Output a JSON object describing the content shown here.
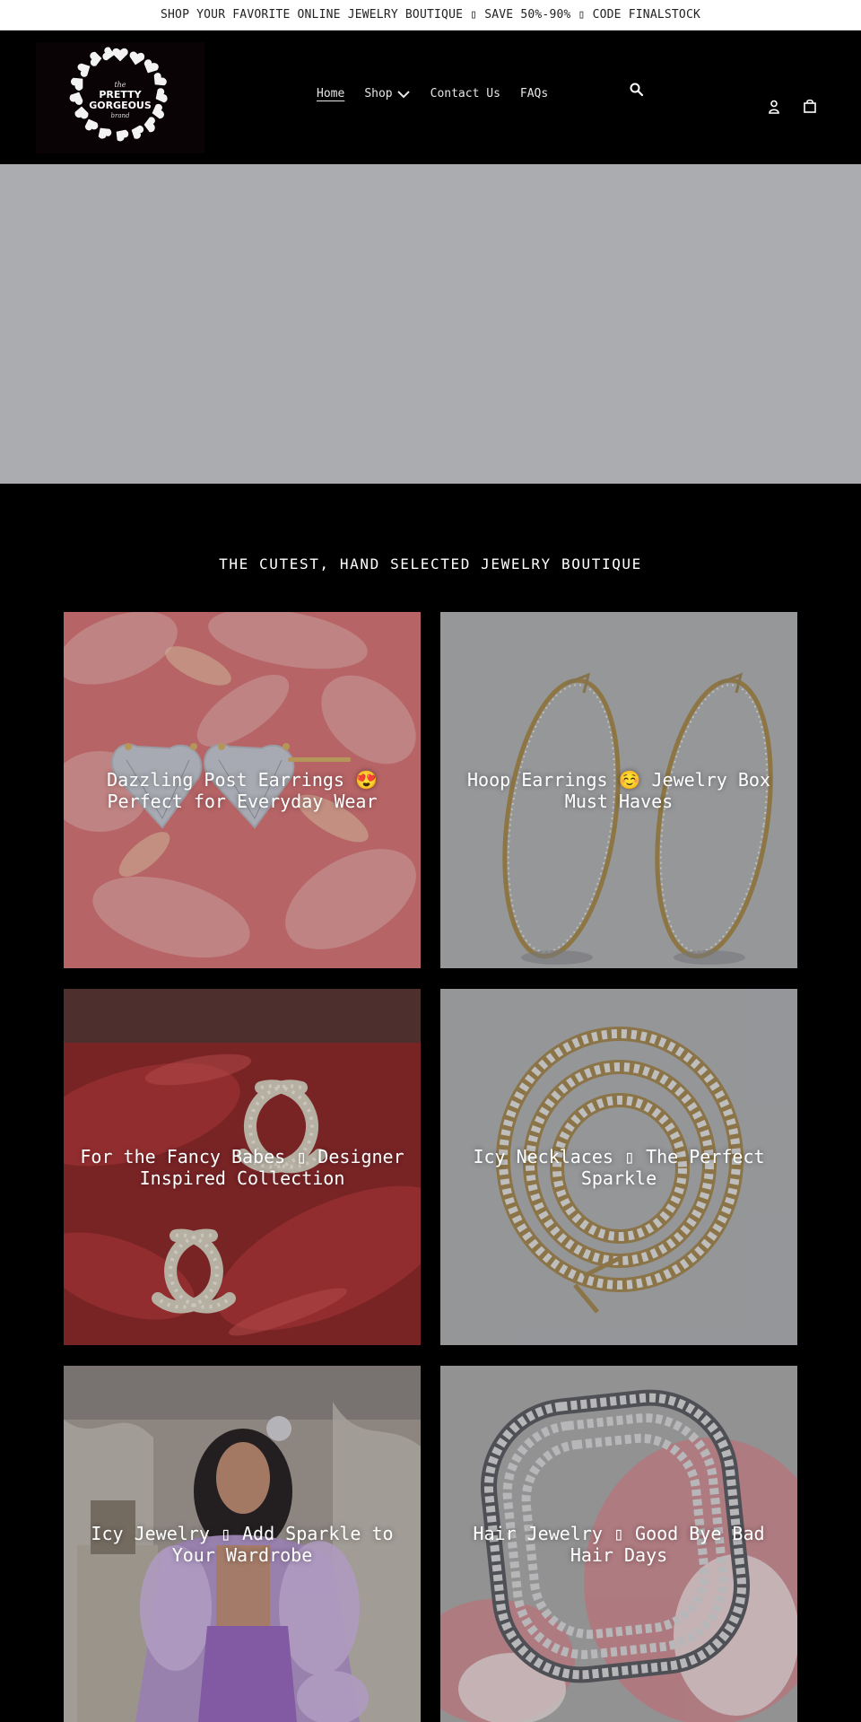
{
  "announcement": {
    "text": "SHOP YOUR FAVORITE ONLINE JEWELRY BOUTIQUE ▯ SAVE 50%-90% ▯ CODE FINALSTOCK"
  },
  "header": {
    "logo_text": {
      "top": "the",
      "line1": "PRETTY",
      "line2": "GORGEOUS",
      "bottom": "brand"
    },
    "nav": [
      {
        "label": "Home"
      },
      {
        "label": "Shop"
      },
      {
        "label": "Contact Us"
      },
      {
        "label": "FAQs"
      }
    ],
    "icons": [
      "search-icon",
      "account-icon",
      "cart-icon"
    ]
  },
  "collections": {
    "heading": "THE CUTEST, HAND SELECTED JEWELRY BOUTIQUE",
    "items": [
      {
        "title": "Dazzling Post Earrings 😍 Perfect for Everyday Wear"
      },
      {
        "title": "Hoop Earrings ☺️ Jewelry Box Must Haves"
      },
      {
        "title": "For the Fancy Babes ▯ Designer Inspired Collection"
      },
      {
        "title": "Icy Necklaces ▯ The Perfect Sparkle"
      },
      {
        "title": "Icy Jewelry ▯ Add Sparkle to Your Wardrobe"
      },
      {
        "title": "Hair Jewelry ▯ Good Bye Bad Hair Days"
      }
    ]
  },
  "colors": {
    "page_background": "#000000",
    "announcement_background": "#ffffff",
    "hero_placeholder": "#abacaf"
  }
}
